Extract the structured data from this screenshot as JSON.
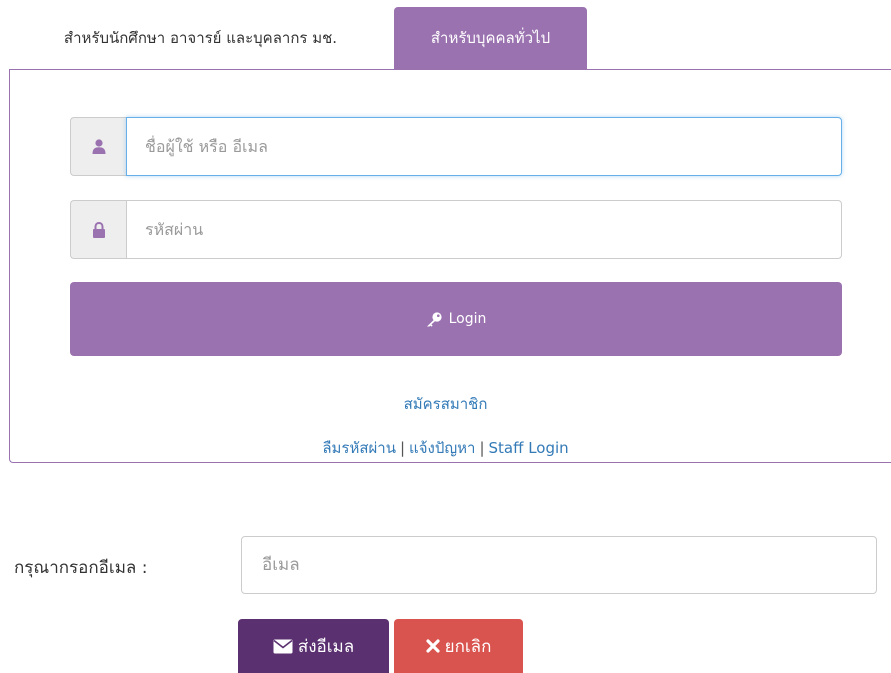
{
  "tabs": {
    "students": "สำหรับนักศึกษา อาจารย์ และบุคลากร มช.",
    "general": "สำหรับบุคคลทั่วไป"
  },
  "login_form": {
    "username_placeholder": "ชื่อผู้ใช้ หรือ อีเมล",
    "password_placeholder": "รหัสผ่าน",
    "login_label": "Login",
    "register_link": "สมัครสมาชิก",
    "forgot_password_link": "ลืมรหัสผ่าน",
    "separator": "|",
    "report_issue_link": "แจ้งปัญหา",
    "staff_login_link": "Staff Login"
  },
  "forgot_form": {
    "email_label": "กรุณากรอกอีเมล :",
    "email_placeholder": "อีเมล",
    "send_label": "ส่งอีเมล",
    "cancel_label": "ยกเลิก"
  },
  "colors": {
    "accent": "#9b72b0",
    "send_button": "#5b3070",
    "cancel_button": "#d9534f",
    "link": "#337ab7"
  },
  "icons": {
    "username": "user-icon",
    "password": "lock-icon",
    "login": "key-icon",
    "send": "envelope-icon",
    "cancel": "close-icon"
  }
}
